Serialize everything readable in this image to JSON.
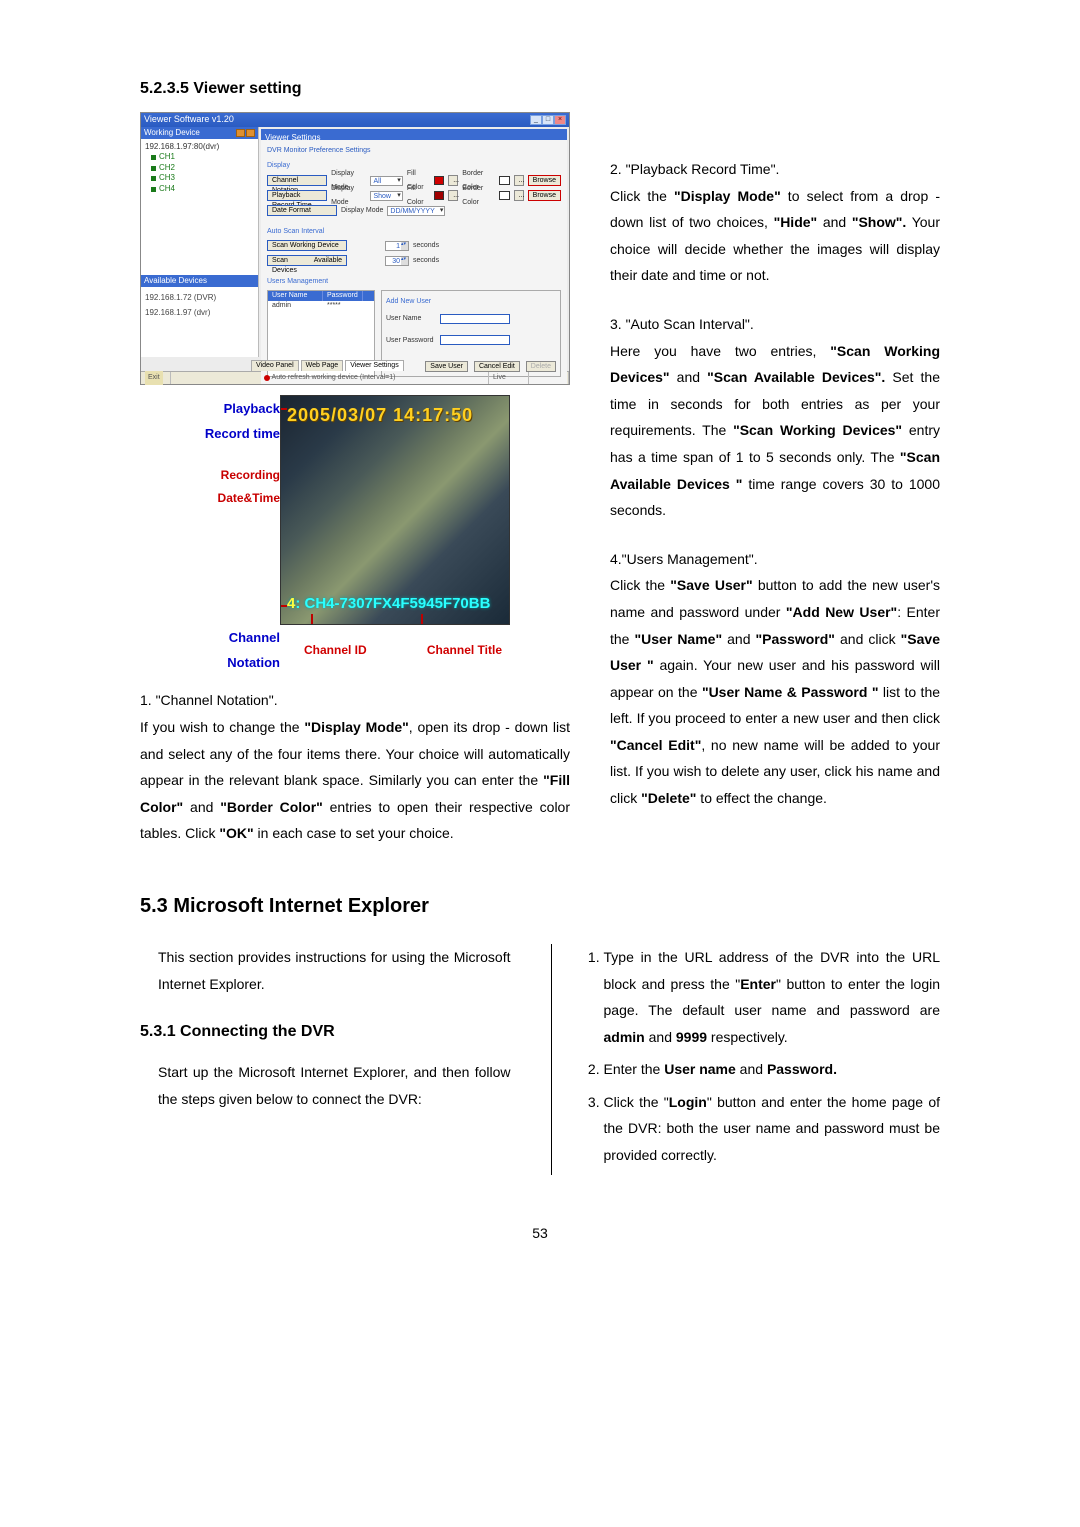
{
  "section1_heading": "5.2.3.5  Viewer setting",
  "fig1": {
    "title": "Viewer Software v1.20",
    "win_min": "_",
    "win_max": "□",
    "win_close": "×",
    "left_hdr1": "Working Device",
    "dev1": "192.168.1.97:80(dvr)",
    "ch1": "CH1",
    "ch2": "CH2",
    "ch3": "CH3",
    "ch4": "CH4",
    "left_hdr2": "Available Devices",
    "avail1": "192.168.1.72 (DVR)",
    "avail2": "192.168.1.97 (dvr)",
    "right_tab": "Viewer Settings",
    "panel_hdr": "DVR Monitor Preference Settings",
    "fs_display": "Display",
    "channel_notation_btn": "Channel Notation",
    "display_mode_lbl": "Display Mode",
    "display_mode_val1": "All",
    "fill_color_lbl": "Fill Color",
    "border_color_lbl": "Border Color",
    "browse_btn": "Browse",
    "playback_record_btn": "Playback Record Time",
    "display_mode_val2": "Show",
    "date_format_btn": "Date Format",
    "date_format_val": "DD/MM/YYYY",
    "fs_autoscan": "Auto Scan Interval",
    "scan_working_btn": "Scan Working Device",
    "scan_working_val": "1",
    "seconds_lbl": "seconds",
    "scan_avail_btn": "Scan Available Devices",
    "scan_avail_val": "30",
    "fs_users": "Users Management",
    "col_user": "User Name",
    "col_pass": "Password",
    "user_row_name": "admin",
    "user_row_pass": "*****",
    "addnew_title": "Add New User",
    "uname_lbl": "User Name",
    "upass_lbl": "User Password",
    "save_user_btn": "Save User",
    "cancel_edit_btn": "Cancel Edit",
    "delete_btn": "Delete",
    "tab1": "Video Panel",
    "tab2": "Web Page",
    "tab3": "Viewer Settings",
    "status_exit": "Exit",
    "status_msg": "Auto refresh working device (Interval=1)",
    "status_tail": "Live",
    "swatch_red": "#d00000",
    "swatch_white": "#ffffff",
    "swatch_darkred": "#a00000"
  },
  "fig2": {
    "playback1": "Playback",
    "playback2": "Record time",
    "recording1": "Recording",
    "recording2": "Date&Time",
    "channel1": "Channel",
    "channel2": "Notation",
    "timestamp": "2005/03/07 14:17:50",
    "chan_id": "4",
    "chan_title": "CH4-7307FX4F5945F70BB",
    "bottom_left": "Channel ID",
    "bottom_right": "Channel Title"
  },
  "left_col": {
    "h1": "1. \"Channel Notation\".",
    "p1a": "If you wish to change the ",
    "p1b": "\"Display Mode\"",
    "p1c": ", open its drop - down list and select any of the four items there. Your choice will automatically appear in the relevant blank space. Similarly you can enter the ",
    "p1d": "\"Fill Color\"",
    "p1e": " and ",
    "p1f": "\"Border Color\"",
    "p1g": " entries to open their respective color tables. Click ",
    "p1h": "\"OK\"",
    "p1i": " in each case to set your choice."
  },
  "right_col": {
    "h2": "2. \"Playback Record Time\".",
    "p2a": "Click the ",
    "p2b": "\"Display Mode\"",
    "p2c": " to select from a drop - down list of two choices, ",
    "p2d": "\"Hide\"",
    "p2e": " and ",
    "p2f": "\"Show\".",
    "p2g": " Your choice will decide whether the images will display their date and time or not.",
    "h3": "3. \"Auto Scan Interval\".",
    "p3a": "Here you have two entries, ",
    "p3b": "\"Scan Working Devices\"",
    "p3c": " and ",
    "p3d": "\"Scan Available Devices\".",
    "p3e": " Set the time in seconds for both entries as per your requirements. The ",
    "p3f": "\"Scan Working Devices\"",
    "p3g": " entry has a time span of 1 to 5 seconds only. The  ",
    "p3h": "\"Scan Available Devices \"",
    "p3i": " time range covers 30 to 1000 seconds.",
    "h4": "4.\"Users Management\".",
    "p4a": "Click the ",
    "p4b": "\"Save User\"",
    "p4c": " button to add the new user's name and password under ",
    "p4d": "\"Add New User\"",
    "p4e": ": Enter the ",
    "p4f": "\"User Name\"",
    "p4g": " and ",
    "p4h": "\"Password\"",
    "p4i": " and click ",
    "p4j": "\"Save User \"",
    "p4k": " again. Your new user and his password will appear on the ",
    "p4l": "\"User Name & Password \"",
    "p4m": " list to the left. If you proceed to enter a new user and then click ",
    "p4n": "\"Cancel Edit\"",
    "p4o": ", no new name will be added to your list. If you wish to delete any user, click his name and click ",
    "p4p": "\"Delete\"",
    "p4q": " to effect the change."
  },
  "mid_heading": "5.3 Microsoft Internet Explorer",
  "sec531_intro": "This section provides instructions for using the Microsoft Internet Explorer.",
  "sec531_heading": "5.3.1 Connecting the DVR",
  "sec531_p1": "Start up the Microsoft Internet Explorer, and then follow the steps given below to connect the DVR:",
  "steps": {
    "s1a": "Type in the URL address of the DVR into the URL block and press the \"",
    "s1b": "Enter",
    "s1c": "\" button to enter the login page. The default user name and password are ",
    "s1d": "admin",
    "s1e": " and ",
    "s1f": "9999",
    "s1g": " respectively.",
    "s2a": "Enter the ",
    "s2b": "User name",
    "s2c": " and ",
    "s2d": "Password.",
    "s3a": "Click the \"",
    "s3b": "Login",
    "s3c": "\" button and enter the home page of the DVR: both the user name and password must be provided correctly."
  },
  "page_num": "53"
}
